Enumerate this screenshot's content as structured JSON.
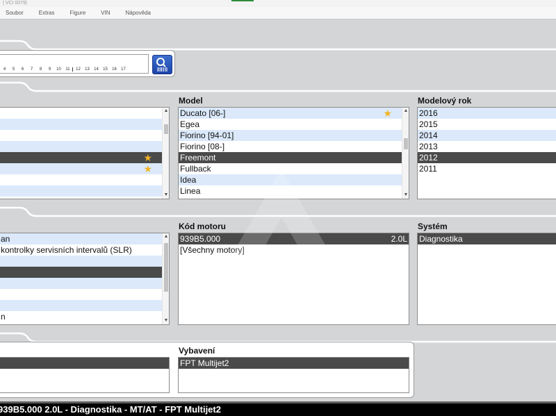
{
  "window": {
    "title_fragment": "| VCI 0079|"
  },
  "menu": [
    "Soubor",
    "Extras",
    "Figure",
    "VIN",
    "Nápověda"
  ],
  "vin_ruler": [
    "4",
    "5",
    "6",
    "7",
    "8",
    "9",
    "10",
    "11",
    "12",
    "13",
    "14",
    "15",
    "16",
    "17"
  ],
  "colors": {
    "selected": "#4a4a4a",
    "alt_row": "#dbe9fb",
    "star": "#f0b323",
    "search_button": "#2a56bf"
  },
  "brand_list": {
    "items": [
      {
        "label": "",
        "style": "plain",
        "star": false
      },
      {
        "label": "",
        "style": "alt",
        "star": false
      },
      {
        "label": "",
        "style": "plain",
        "star": false
      },
      {
        "label": "",
        "style": "alt",
        "star": false
      },
      {
        "label": "",
        "style": "sel",
        "star": true
      },
      {
        "label": "",
        "style": "alt",
        "star": true
      },
      {
        "label": "",
        "style": "plain",
        "star": false
      },
      {
        "label": "",
        "style": "alt",
        "star": false
      }
    ]
  },
  "model": {
    "label": "Model",
    "items": [
      {
        "label": "Ducato [06-]",
        "style": "alt",
        "star": true
      },
      {
        "label": "Egea",
        "style": "plain",
        "star": false
      },
      {
        "label": "Fiorino [94-01]",
        "style": "alt",
        "star": false
      },
      {
        "label": "Fiorino [08-]",
        "style": "plain",
        "star": false
      },
      {
        "label": "Freemont",
        "style": "sel",
        "star": false
      },
      {
        "label": "Fullback",
        "style": "plain",
        "star": false
      },
      {
        "label": "Idea",
        "style": "alt",
        "star": false
      },
      {
        "label": "Linea",
        "style": "plain",
        "star": false
      }
    ]
  },
  "model_year": {
    "label": "Modelový rok",
    "items": [
      {
        "label": "2016",
        "style": "alt"
      },
      {
        "label": "2015",
        "style": "plain"
      },
      {
        "label": "2014",
        "style": "alt"
      },
      {
        "label": "2013",
        "style": "plain"
      },
      {
        "label": "2012",
        "style": "sel"
      },
      {
        "label": "2011",
        "style": "plain"
      }
    ]
  },
  "function_list": {
    "items": [
      {
        "label": "an",
        "style": "alt"
      },
      {
        "label": "kontrolky servisních intervalů (SLR)",
        "style": "plain"
      },
      {
        "label": "",
        "style": "alt"
      },
      {
        "label": "",
        "style": "sel"
      },
      {
        "label": "",
        "style": "alt"
      },
      {
        "label": "",
        "style": "plain"
      },
      {
        "label": "",
        "style": "alt"
      },
      {
        "label": "n",
        "style": "plain"
      }
    ]
  },
  "engine_code": {
    "label": "Kód motoru",
    "items": [
      {
        "label": "939B5.000",
        "right": "2.0L",
        "style": "sel"
      },
      {
        "label": "[Všechny motory]",
        "right": "",
        "style": "plain"
      }
    ]
  },
  "system": {
    "label": "Systém",
    "items": [
      {
        "label": "Diagnostika",
        "style": "sel"
      }
    ]
  },
  "equipment": {
    "label": "Vybavení",
    "items": [
      {
        "label": "FPT Multijet2",
        "style": "sel"
      }
    ]
  },
  "left_equipment_list": {
    "items": [
      {
        "label": "",
        "style": "sel"
      }
    ]
  },
  "status_bar": {
    "text": "939B5.000 2.0L - Diagnostika - MT/AT - FPT Multijet2"
  }
}
